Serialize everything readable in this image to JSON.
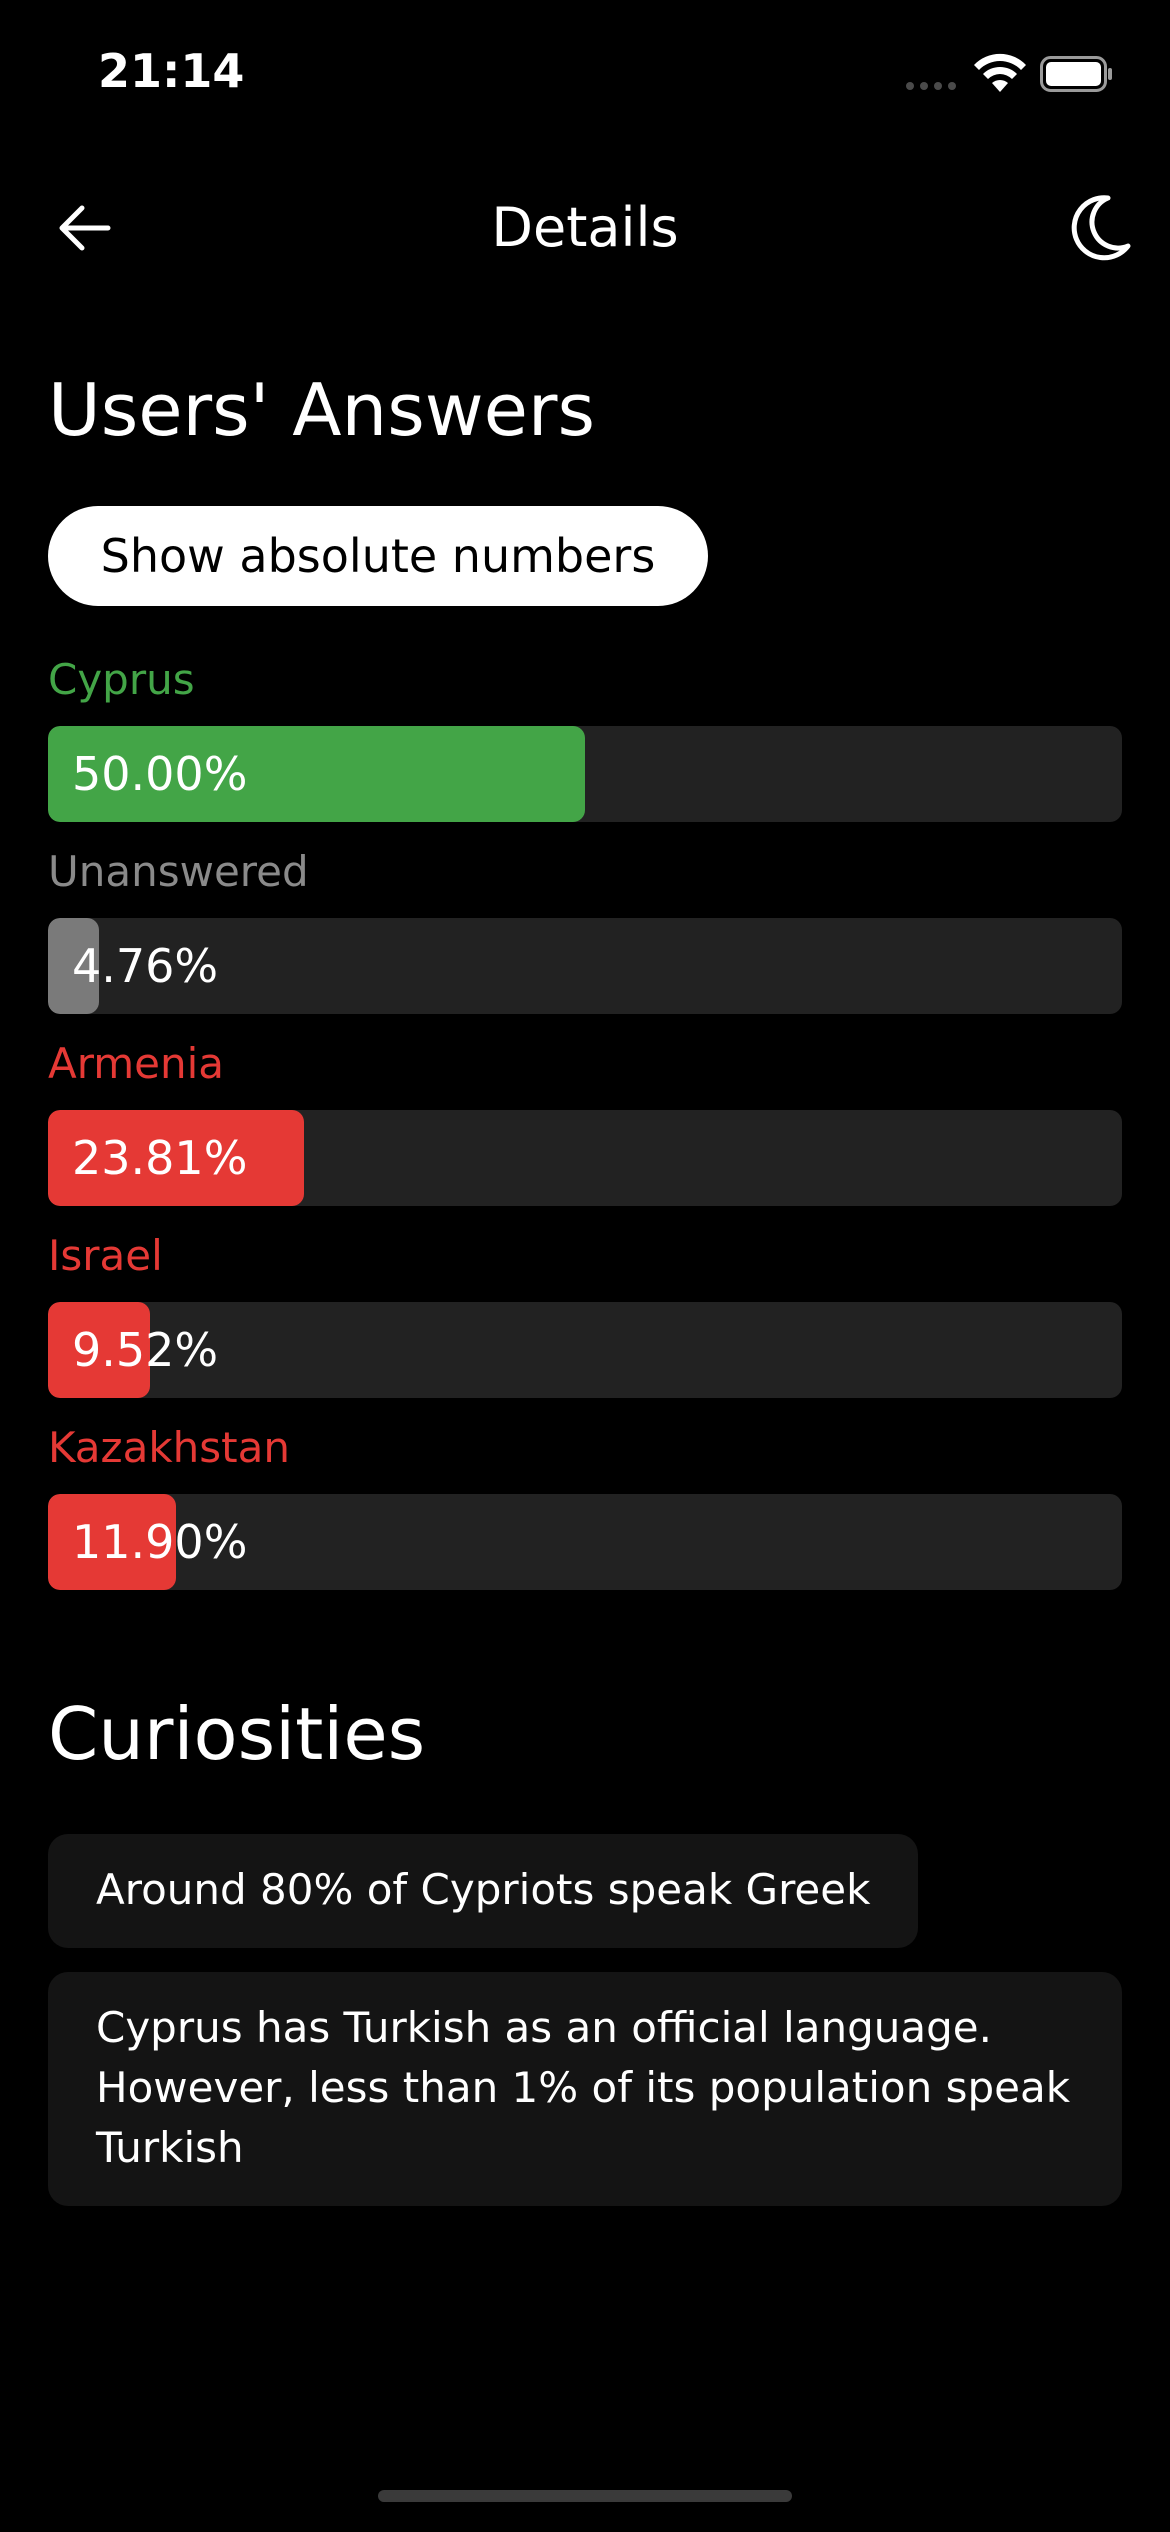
{
  "status_bar": {
    "time": "21:14"
  },
  "nav": {
    "title": "Details",
    "back_icon": "arrow-left-icon",
    "theme_icon": "moon-icon"
  },
  "answers_section": {
    "heading": "Users' Answers",
    "toggle_label": "Show absolute numbers",
    "items": [
      {
        "label": "Cyprus",
        "percent_text": "50.00%",
        "percent": 50.0,
        "color": "#43a547",
        "label_color": "#43a547"
      },
      {
        "label": "Unanswered",
        "percent_text": "4.76%",
        "percent": 4.76,
        "color": "#7a7a7a",
        "label_color": "#8a8a8a"
      },
      {
        "label": "Armenia",
        "percent_text": "23.81%",
        "percent": 23.81,
        "color": "#e53935",
        "label_color": "#e53935"
      },
      {
        "label": "Israel",
        "percent_text": "9.52%",
        "percent": 9.52,
        "color": "#e53935",
        "label_color": "#e53935"
      },
      {
        "label": "Kazakhstan",
        "percent_text": "11.90%",
        "percent": 11.9,
        "color": "#e53935",
        "label_color": "#e53935"
      }
    ]
  },
  "curiosities_section": {
    "heading": "Curiosities",
    "items": [
      "Around 80% of Cypriots speak Greek",
      "Cyprus has Turkish as an official language. However, less than 1% of its population speak Turkish"
    ]
  },
  "colors": {
    "background": "#000000",
    "track": "#222222",
    "card": "#141414",
    "correct": "#43a547",
    "wrong": "#e53935",
    "unanswered": "#7a7a7a"
  }
}
